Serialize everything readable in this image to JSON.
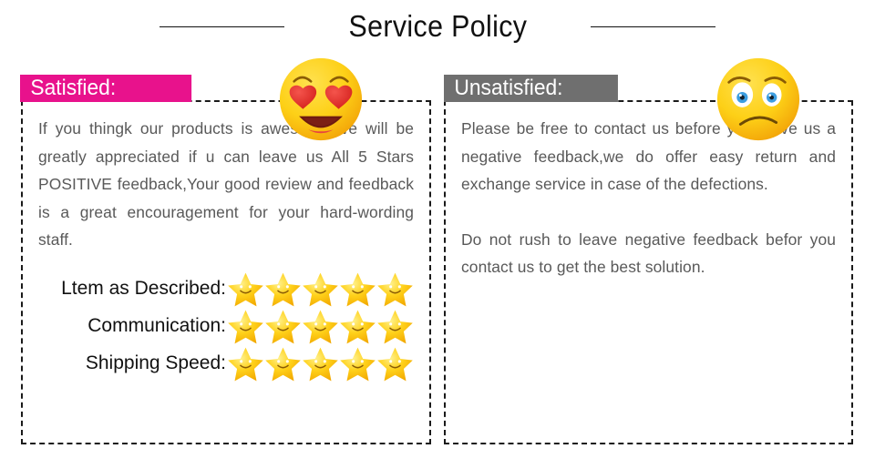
{
  "header": {
    "title": "Service Policy",
    "left_rule": "horizontal-rule",
    "right_rule": "horizontal-rule"
  },
  "satisfied_panel": {
    "badge_label": "Satisfied:",
    "badge_color": "#e8128c",
    "badge_text_color": "#ffffff",
    "emoji": "smiling-face-with-heart-eyes",
    "paragraph": "If you thingk our products is awesome,We will be greatly appreciated if u can leave us All 5 Stars POSITIVE feedback,Your good review and feedback is a great encouragement for your hard-wording staff.",
    "ratings": [
      {
        "label": "Ltem as Described:",
        "stars": 5
      },
      {
        "label": "Communication:",
        "stars": 5
      },
      {
        "label": "Shipping Speed:",
        "stars": 5
      }
    ],
    "star_color": "#fdc010"
  },
  "unsatisfied_panel": {
    "badge_label": "Unsatisfied:",
    "badge_color": "#6f6f6f",
    "badge_text_color": "#ffffff",
    "emoji": "worried-face",
    "paragraph_1": "Please be free to contact us before you leave us a negative feedback,we do offer easy return and exchange service in case of the defections.",
    "paragraph_2": "Do not rush to leave negative feedback befor you contact us to get the best solution."
  },
  "style": {
    "body_text_color": "#595959",
    "border_color": "#1a1a1a",
    "background": "#ffffff"
  }
}
